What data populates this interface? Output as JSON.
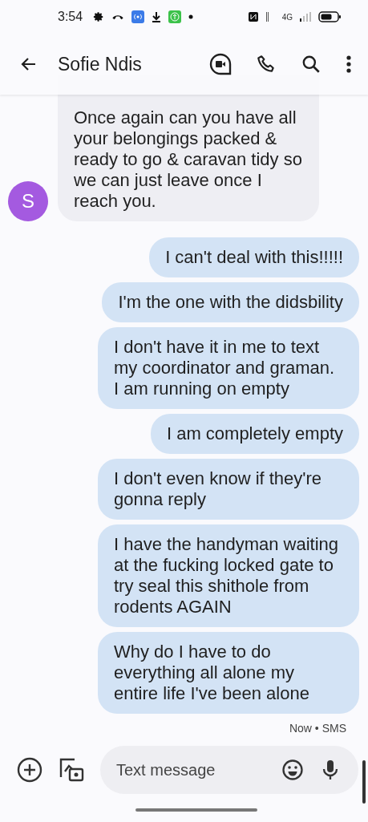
{
  "status_bar": {
    "time": "3:54",
    "network": "4G"
  },
  "header": {
    "contact": "Sofie Ndis"
  },
  "messages": [
    {
      "kind": "incoming",
      "text": "Once again can you have all your belongings packed & ready to go & caravan tidy so we can just leave once I reach you.",
      "avatar": "S",
      "color": "#a45ae0"
    },
    {
      "kind": "outgoing",
      "text": "I can't deal with this!!!!!"
    },
    {
      "kind": "outgoing",
      "text": "I'm the one with the didsbility"
    },
    {
      "kind": "outgoing",
      "text": "I don't have it in me to text my coordinator and graman. I am running on empty"
    },
    {
      "kind": "outgoing",
      "text": "I am completely empty"
    },
    {
      "kind": "outgoing",
      "text": "I don't even know if they're gonna reply"
    },
    {
      "kind": "outgoing",
      "text": "I have the handyman waiting at the fucking locked gate to try seal this shithole from rodents AGAIN"
    },
    {
      "kind": "outgoing",
      "text": "Why do I have to do everything all alone my entire life I've been alone"
    }
  ],
  "timestamp": "Now • SMS",
  "composer": {
    "placeholder": "Text message"
  }
}
